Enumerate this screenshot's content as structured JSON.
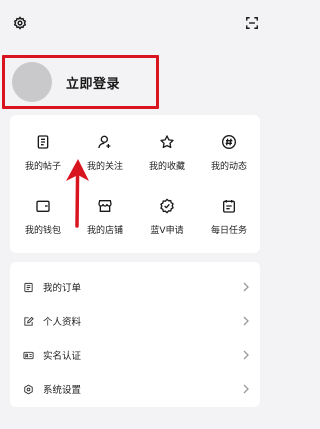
{
  "header": {
    "settings_icon": "gear-icon",
    "scan_icon": "scan-icon"
  },
  "profile": {
    "login_label": "立即登录"
  },
  "quick_grid": [
    {
      "label": "我的帖子",
      "icon": "post-icon"
    },
    {
      "label": "我的关注",
      "icon": "follow-icon"
    },
    {
      "label": "我的收藏",
      "icon": "star-icon"
    },
    {
      "label": "我的动态",
      "icon": "hashtag-icon"
    },
    {
      "label": "我的钱包",
      "icon": "wallet-icon"
    },
    {
      "label": "我的店铺",
      "icon": "store-icon"
    },
    {
      "label": "蓝V申请",
      "icon": "verified-icon"
    },
    {
      "label": "每日任务",
      "icon": "calendar-icon"
    }
  ],
  "menu": [
    {
      "label": "我的订单",
      "icon": "order-icon"
    },
    {
      "label": "个人资料",
      "icon": "edit-profile-icon"
    },
    {
      "label": "实名认证",
      "icon": "id-card-icon"
    },
    {
      "label": "系统设置",
      "icon": "settings-icon"
    }
  ],
  "colors": {
    "annotation": "#d8141f",
    "background": "#f3f3f5"
  }
}
